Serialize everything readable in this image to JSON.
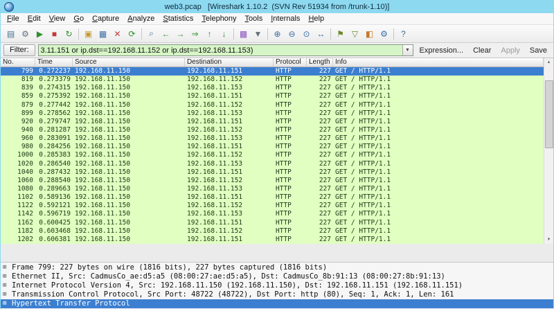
{
  "window": {
    "title": "web3.pcap   [Wireshark 1.10.2  (SVN Rev 51934 from /trunk-1.10)]"
  },
  "menu": {
    "items": [
      "File",
      "Edit",
      "View",
      "Go",
      "Capture",
      "Analyze",
      "Statistics",
      "Telephony",
      "Tools",
      "Internals",
      "Help"
    ]
  },
  "toolbar": {
    "buttons": [
      {
        "name": "interface-list-icon",
        "glyph": "▤",
        "color": "#46718f"
      },
      {
        "name": "capture-options-icon",
        "glyph": "⚙",
        "color": "#5f6f7f"
      },
      {
        "name": "capture-start-icon",
        "glyph": "▶",
        "color": "#2f8f2f"
      },
      {
        "name": "capture-stop-icon",
        "glyph": "■",
        "color": "#c03a3a"
      },
      {
        "name": "capture-restart-icon",
        "glyph": "↻",
        "color": "#2f8f2f"
      },
      {
        "sep": true
      },
      {
        "name": "open-file-icon",
        "glyph": "▣",
        "color": "#c89a30"
      },
      {
        "name": "save-file-icon",
        "glyph": "▦",
        "color": "#3a6ea5"
      },
      {
        "name": "close-file-icon",
        "glyph": "✕",
        "color": "#c03a3a"
      },
      {
        "name": "reload-icon",
        "glyph": "⟳",
        "color": "#2f8f2f"
      },
      {
        "sep": true
      },
      {
        "name": "find-packet-icon",
        "glyph": "⌕",
        "color": "#3a6ea5"
      },
      {
        "name": "go-back-icon",
        "glyph": "←",
        "color": "#2f8f2f"
      },
      {
        "name": "go-forward-icon",
        "glyph": "→",
        "color": "#2f8f2f"
      },
      {
        "name": "go-to-packet-icon",
        "glyph": "⇒",
        "color": "#2f8f2f"
      },
      {
        "name": "go-first-icon",
        "glyph": "↑",
        "color": "#2f8f2f"
      },
      {
        "name": "go-last-icon",
        "glyph": "↓",
        "color": "#2f8f2f"
      },
      {
        "sep": true
      },
      {
        "name": "colorize-icon",
        "glyph": "▩",
        "color": "#8a56c0"
      },
      {
        "name": "auto-scroll-icon",
        "glyph": "▼",
        "color": "#66707a"
      },
      {
        "sep": true
      },
      {
        "name": "zoom-in-icon",
        "glyph": "⊕",
        "color": "#3a6ea5"
      },
      {
        "name": "zoom-out-icon",
        "glyph": "⊖",
        "color": "#3a6ea5"
      },
      {
        "name": "zoom-100-icon",
        "glyph": "⊙",
        "color": "#3a6ea5"
      },
      {
        "name": "fit-columns-icon",
        "glyph": "↔",
        "color": "#3a6ea5"
      },
      {
        "sep": true
      },
      {
        "name": "capture-filters-icon",
        "glyph": "⚑",
        "color": "#6a8a2a"
      },
      {
        "name": "display-filters-icon",
        "glyph": "▽",
        "color": "#6a8a2a"
      },
      {
        "name": "coloring-rules-icon",
        "glyph": "◧",
        "color": "#c87828"
      },
      {
        "name": "preferences-icon",
        "glyph": "⚙",
        "color": "#3a6ea5"
      },
      {
        "sep": true
      },
      {
        "name": "help-icon",
        "glyph": "?",
        "color": "#3a6ea5"
      }
    ]
  },
  "filter": {
    "label": "Filter:",
    "value": "3.11.151 or ip.dst==192.168.11.152 or ip.dst==192.168.11.153)",
    "dropdown_glyph": "▼",
    "expression": "Expression...",
    "clear": "Clear",
    "apply": "Apply",
    "save": "Save"
  },
  "packet_list": {
    "columns": [
      "No.",
      "Time",
      "Source",
      "Destination",
      "Protocol",
      "Length",
      "Info"
    ],
    "selected_index": 0,
    "rows": [
      [
        "799",
        "0.272237",
        "192.168.11.150",
        "192.168.11.151",
        "HTTP",
        "227",
        "GET / HTTP/1.1"
      ],
      [
        "819",
        "0.273379",
        "192.168.11.150",
        "192.168.11.152",
        "HTTP",
        "227",
        "GET / HTTP/1.1"
      ],
      [
        "839",
        "0.274315",
        "192.168.11.150",
        "192.168.11.153",
        "HTTP",
        "227",
        "GET / HTTP/1.1"
      ],
      [
        "859",
        "0.275392",
        "192.168.11.150",
        "192.168.11.151",
        "HTTP",
        "227",
        "GET / HTTP/1.1"
      ],
      [
        "879",
        "0.277442",
        "192.168.11.150",
        "192.168.11.152",
        "HTTP",
        "227",
        "GET / HTTP/1.1"
      ],
      [
        "899",
        "0.278562",
        "192.168.11.150",
        "192.168.11.153",
        "HTTP",
        "227",
        "GET / HTTP/1.1"
      ],
      [
        "920",
        "0.279747",
        "192.168.11.150",
        "192.168.11.151",
        "HTTP",
        "227",
        "GET / HTTP/1.1"
      ],
      [
        "940",
        "0.281287",
        "192.168.11.150",
        "192.168.11.152",
        "HTTP",
        "227",
        "GET / HTTP/1.1"
      ],
      [
        "960",
        "0.283091",
        "192.168.11.150",
        "192.168.11.153",
        "HTTP",
        "227",
        "GET / HTTP/1.1"
      ],
      [
        "980",
        "0.284256",
        "192.168.11.150",
        "192.168.11.151",
        "HTTP",
        "227",
        "GET / HTTP/1.1"
      ],
      [
        "1000",
        "0.285383",
        "192.168.11.150",
        "192.168.11.152",
        "HTTP",
        "227",
        "GET / HTTP/1.1"
      ],
      [
        "1020",
        "0.286540",
        "192.168.11.150",
        "192.168.11.153",
        "HTTP",
        "227",
        "GET / HTTP/1.1"
      ],
      [
        "1040",
        "0.287432",
        "192.168.11.150",
        "192.168.11.151",
        "HTTP",
        "227",
        "GET / HTTP/1.1"
      ],
      [
        "1060",
        "0.288540",
        "192.168.11.150",
        "192.168.11.152",
        "HTTP",
        "227",
        "GET / HTTP/1.1"
      ],
      [
        "1080",
        "0.289663",
        "192.168.11.150",
        "192.168.11.153",
        "HTTP",
        "227",
        "GET / HTTP/1.1"
      ],
      [
        "1102",
        "0.589136",
        "192.168.11.150",
        "192.168.11.151",
        "HTTP",
        "227",
        "GET / HTTP/1.1"
      ],
      [
        "1122",
        "0.592121",
        "192.168.11.150",
        "192.168.11.152",
        "HTTP",
        "227",
        "GET / HTTP/1.1"
      ],
      [
        "1142",
        "0.596719",
        "192.168.11.150",
        "192.168.11.153",
        "HTTP",
        "227",
        "GET / HTTP/1.1"
      ],
      [
        "1162",
        "0.600425",
        "192.168.11.150",
        "192.168.11.151",
        "HTTP",
        "227",
        "GET / HTTP/1.1"
      ],
      [
        "1182",
        "0.603468",
        "192.168.11.150",
        "192.168.11.152",
        "HTTP",
        "227",
        "GET / HTTP/1.1"
      ],
      [
        "1202",
        "0.606381",
        "192.168.11.150",
        "192.168.11.151",
        "HTTP",
        "227",
        "GET / HTTP/1.1"
      ]
    ]
  },
  "scrollbar": {
    "up_glyph": "▲",
    "down_glyph": "▼"
  },
  "details": {
    "expander_glyph": "⊞",
    "lines": [
      {
        "text": "Frame 799: 227 bytes on wire (1816 bits), 227 bytes captured (1816 bits)",
        "selected": false
      },
      {
        "text": "Ethernet II, Src: CadmusCo_ae:d5:a5 (08:00:27:ae:d5:a5), Dst: CadmusCo_8b:91:13 (08:00:27:8b:91:13)",
        "selected": false
      },
      {
        "text": "Internet Protocol Version 4, Src: 192.168.11.150 (192.168.11.150), Dst: 192.168.11.151 (192.168.11.151)",
        "selected": false
      },
      {
        "text": "Transmission Control Protocol, Src Port: 48722 (48722), Dst Port: http (80), Seq: 1, Ack: 1, Len: 161",
        "selected": false
      },
      {
        "text": "Hypertext Transfer Protocol",
        "selected": true
      }
    ]
  },
  "colors": {
    "titlebar": "#8dd9f0",
    "packet_row_bg": "#e0ffc0",
    "selection": "#3c7fd0",
    "filter_valid_bg": "#d6f5c6"
  }
}
